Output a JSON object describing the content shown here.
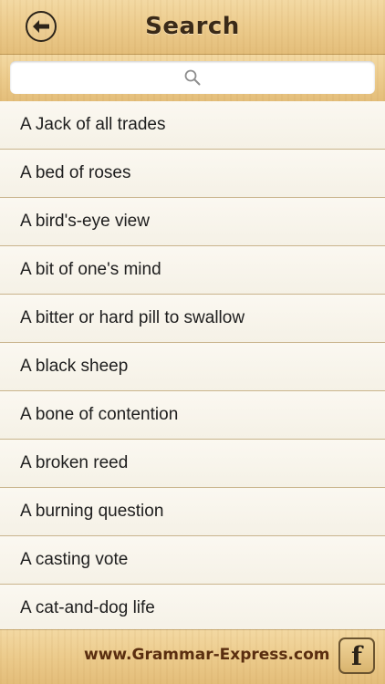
{
  "header": {
    "title": "Search",
    "back_icon": "back-arrow-icon"
  },
  "search": {
    "placeholder": "",
    "value": "",
    "icon": "search-icon"
  },
  "phrases": [
    "A Jack of all trades",
    "A bed of roses",
    "A bird's-eye view",
    "A bit of one's mind",
    "A bitter or hard pill to swallow",
    "A black sheep",
    "A bone of contention",
    "A broken reed",
    "A burning question",
    "A casting vote",
    "A cat-and-dog life"
  ],
  "footer": {
    "link_text": "www.Grammar-Express.com",
    "facebook_label": "f",
    "facebook_icon": "facebook-icon"
  },
  "colors": {
    "wood_light": "#f3d9a3",
    "wood_dark": "#e3bd79",
    "title_text": "#3a2a18",
    "link_text": "#5a2e10",
    "row_divider": "#c9b48c"
  }
}
